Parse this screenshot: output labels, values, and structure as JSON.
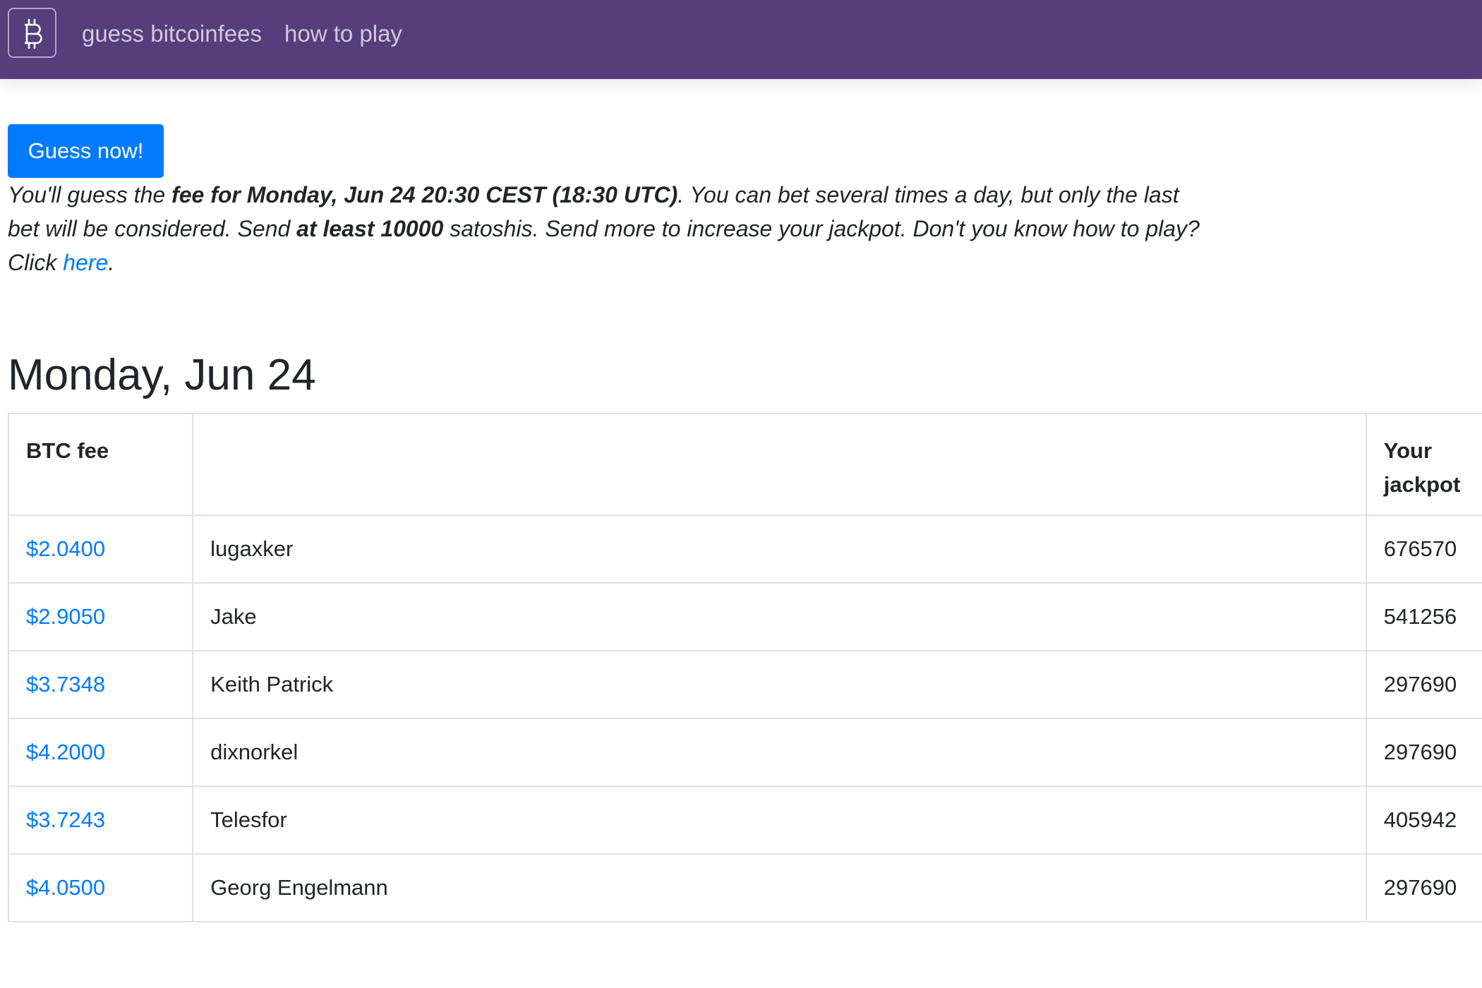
{
  "navbar": {
    "brand_icon": "bitcoin-icon",
    "links": [
      "guess bitcoinfees",
      "how to play"
    ]
  },
  "guess_button": "Guess now!",
  "intro": {
    "t1": "You'll guess the ",
    "b1": "fee for Monday, Jun 24 20:30 CEST (18:30 UTC)",
    "t2": ". You can bet several times a day, but only the last bet will be considered. Send ",
    "b2": "at least 10000",
    "t3": " satoshis. Send more to increase your jackpot. Don't you know how to play? Click ",
    "link": "here",
    "t4": "."
  },
  "day_title": "Monday, Jun 24",
  "table": {
    "headers": [
      "BTC fee",
      "",
      "Your jackpot"
    ],
    "rows": [
      {
        "fee": "$2.0400",
        "name": "lugaxker",
        "jackpot": "676570"
      },
      {
        "fee": "$2.9050",
        "name": "Jake",
        "jackpot": "541256"
      },
      {
        "fee": "$3.7348",
        "name": "Keith Patrick",
        "jackpot": "297690"
      },
      {
        "fee": "$4.2000",
        "name": "dixnorkel",
        "jackpot": "297690"
      },
      {
        "fee": "$3.7243",
        "name": "Telesfor",
        "jackpot": "405942"
      },
      {
        "fee": "$4.0500",
        "name": "Georg Engelmann",
        "jackpot": "297690"
      }
    ]
  },
  "colors": {
    "navbar": "#563d7c",
    "primary": "#007bff",
    "text": "#212529",
    "border": "#dee2e6"
  }
}
